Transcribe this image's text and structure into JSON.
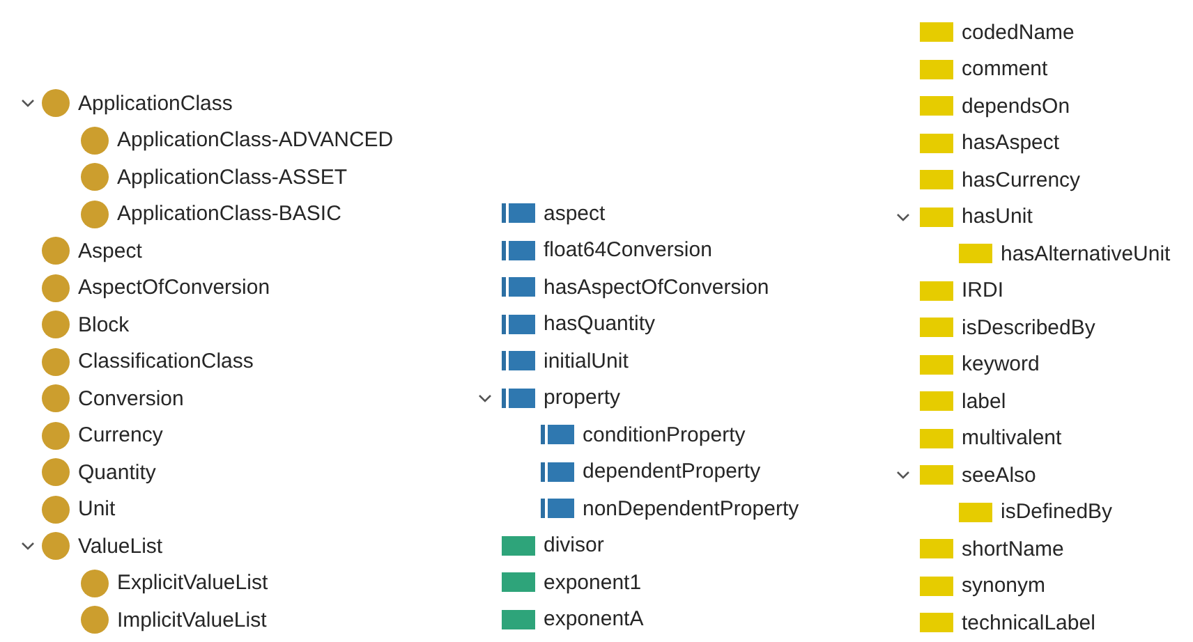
{
  "panels": [
    {
      "items": [
        {
          "label": "ApplicationClass",
          "kind": "class",
          "expanded": true,
          "children": [
            {
              "label": "ApplicationClass-ADVANCED",
              "kind": "class"
            },
            {
              "label": "ApplicationClass-ASSET",
              "kind": "class"
            },
            {
              "label": "ApplicationClass-BASIC",
              "kind": "class"
            }
          ]
        },
        {
          "label": "Aspect",
          "kind": "class"
        },
        {
          "label": "AspectOfConversion",
          "kind": "class"
        },
        {
          "label": "Block",
          "kind": "class"
        },
        {
          "label": "ClassificationClass",
          "kind": "class"
        },
        {
          "label": "Conversion",
          "kind": "class"
        },
        {
          "label": "Currency",
          "kind": "class"
        },
        {
          "label": "Quantity",
          "kind": "class"
        },
        {
          "label": "Unit",
          "kind": "class"
        },
        {
          "label": "ValueList",
          "kind": "class",
          "expanded": true,
          "children": [
            {
              "label": "ExplicitValueList",
              "kind": "class"
            },
            {
              "label": "ImplicitValueList",
              "kind": "class"
            }
          ]
        }
      ]
    },
    {
      "items": [
        {
          "label": "aspect",
          "kind": "object"
        },
        {
          "label": "float64Conversion",
          "kind": "object"
        },
        {
          "label": "hasAspectOfConversion",
          "kind": "object"
        },
        {
          "label": "hasQuantity",
          "kind": "object"
        },
        {
          "label": "initialUnit",
          "kind": "object"
        },
        {
          "label": "property",
          "kind": "object",
          "expanded": true,
          "children": [
            {
              "label": "conditionProperty",
              "kind": "object"
            },
            {
              "label": "dependentProperty",
              "kind": "object"
            },
            {
              "label": "nonDependentProperty",
              "kind": "object"
            }
          ]
        },
        {
          "label": "divisor",
          "kind": "data"
        },
        {
          "label": "exponent1",
          "kind": "data"
        },
        {
          "label": "exponentA",
          "kind": "data"
        }
      ]
    },
    {
      "items": [
        {
          "label": "codedName",
          "kind": "annotation"
        },
        {
          "label": "comment",
          "kind": "annotation"
        },
        {
          "label": "dependsOn",
          "kind": "annotation"
        },
        {
          "label": "hasAspect",
          "kind": "annotation"
        },
        {
          "label": "hasCurrency",
          "kind": "annotation"
        },
        {
          "label": "hasUnit",
          "kind": "annotation",
          "expanded": true,
          "children": [
            {
              "label": "hasAlternativeUnit",
              "kind": "annotation"
            }
          ]
        },
        {
          "label": "IRDI",
          "kind": "annotation"
        },
        {
          "label": "isDescribedBy",
          "kind": "annotation"
        },
        {
          "label": "keyword",
          "kind": "annotation"
        },
        {
          "label": "label",
          "kind": "annotation"
        },
        {
          "label": "multivalent",
          "kind": "annotation"
        },
        {
          "label": "seeAlso",
          "kind": "annotation",
          "expanded": true,
          "children": [
            {
              "label": "isDefinedBy",
              "kind": "annotation"
            }
          ]
        },
        {
          "label": "shortName",
          "kind": "annotation"
        },
        {
          "label": "synonym",
          "kind": "annotation"
        },
        {
          "label": "technicalLabel",
          "kind": "annotation"
        }
      ]
    }
  ]
}
